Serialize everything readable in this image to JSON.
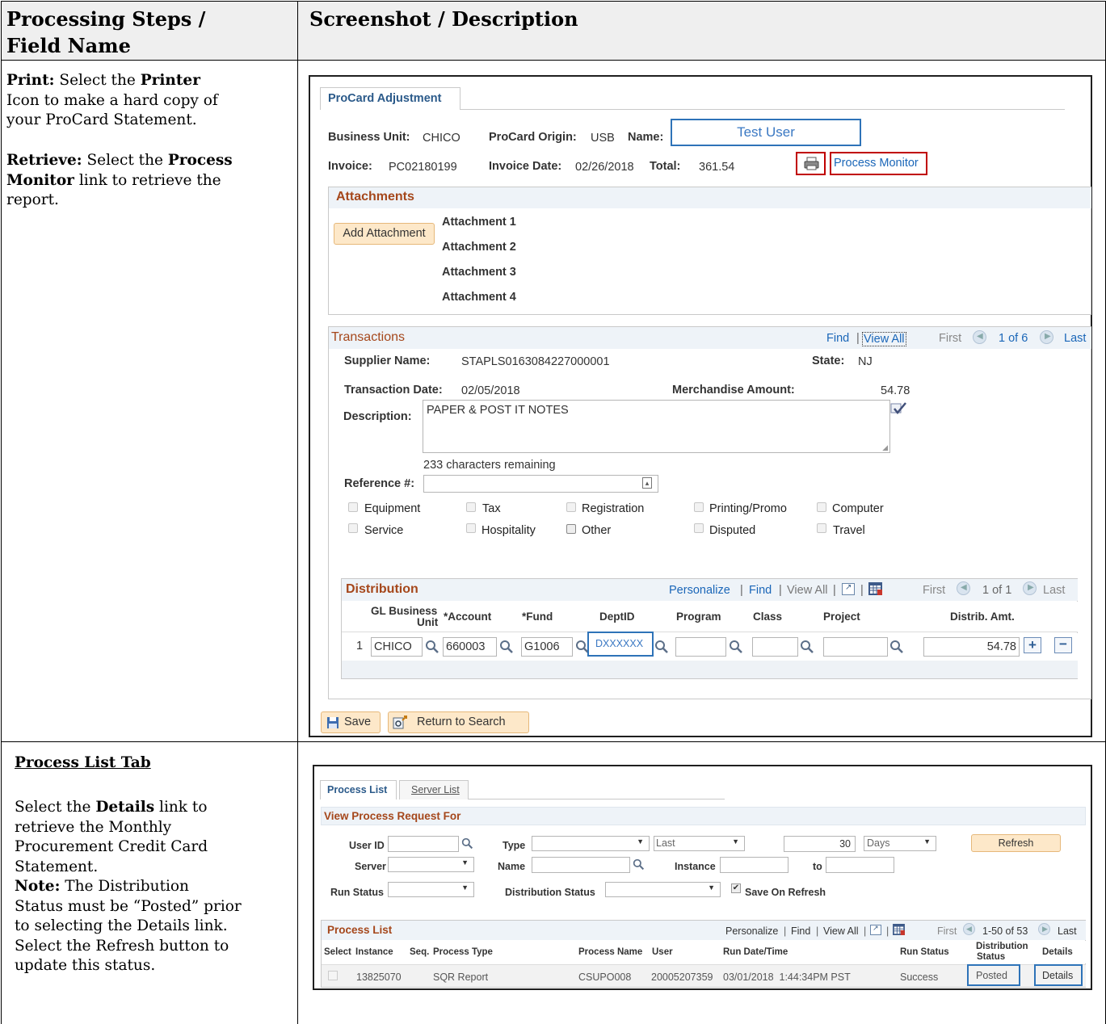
{
  "header": {
    "col1_line1": "Processing Steps /",
    "col1_line2": "Field Name",
    "col2": "Screenshot / Description"
  },
  "row1": {
    "print_label": "Print:",
    "print_t1": " Select the ",
    "print_bold": "Printer",
    "print_t2": "Icon to make a hard copy of",
    "print_t3": "your ProCard Statement.",
    "retrieve_label": "Retrieve:",
    "retrieve_t1": " Select the ",
    "retrieve_bold1": "Process",
    "retrieve_bold2": "Monitor",
    "retrieve_t2": " link to retrieve the",
    "retrieve_t3": "report."
  },
  "procard": {
    "tab": "ProCard Adjustment",
    "bu_label": "Business Unit:",
    "bu_value": "CHICO",
    "origin_label": "ProCard Origin:",
    "origin_value": "USB",
    "name_label": "Name:",
    "name_value": "Test User",
    "invoice_label": "Invoice:",
    "invoice_value": "PC02180199",
    "invdate_label": "Invoice Date:",
    "invdate_value": "02/26/2018",
    "total_label": "Total:",
    "total_value": "361.54",
    "process_monitor": "Process Monitor",
    "attachments_title": "Attachments",
    "add_attachment": "Add Attachment",
    "attachments": [
      "Attachment 1",
      "Attachment 2",
      "Attachment 3",
      "Attachment 4"
    ],
    "transactions_title": "Transactions",
    "find": "Find",
    "view_all": "View All",
    "first": "First",
    "page": "1 of 6",
    "last": "Last",
    "supplier_label": "Supplier Name:",
    "supplier_value": "STAPLS0163084227000001",
    "state_label": "State:",
    "state_value": "NJ",
    "trans_date_label": "Transaction Date:",
    "trans_date_value": "02/05/2018",
    "merch_label": "Merchandise Amount:",
    "merch_value": "54.78",
    "desc_label": "Description:",
    "desc_value": "PAPER & POST IT NOTES",
    "chars_remaining": "233 characters remaining",
    "ref_label": "Reference #:",
    "checkboxes": [
      "Equipment",
      "Tax",
      "Registration",
      "Printing/Promo",
      "Computer",
      "Service",
      "Hospitality",
      "Other",
      "Disputed",
      "Travel"
    ],
    "dist_title": "Distribution",
    "personalize": "Personalize",
    "d_find": "Find",
    "d_view_all": "View All",
    "d_first": "First",
    "d_page": "1 of 1",
    "d_last": "Last",
    "cols": {
      "gl1": "GL Business",
      "gl2": "Unit",
      "account": "*Account",
      "fund": "*Fund",
      "dept": "DeptID",
      "program": "Program",
      "class": "Class",
      "project": "Project",
      "amt": "Distrib. Amt."
    },
    "row": {
      "num": "1",
      "gl": "CHICO",
      "account": "660003",
      "fund": "G1006",
      "dept": "DXXXXXX",
      "amt": "54.78"
    },
    "save": "Save",
    "return": "Return to Search"
  },
  "row2": {
    "title": "Process List Tab",
    "lines": [
      "Select the ",
      "Details",
      " link to",
      "retrieve the Monthly",
      "Procurement Credit Card",
      "Statement."
    ],
    "note_label": "Note:",
    "note_lines": [
      " The Distribution",
      "Status must be “Posted” prior",
      "to selecting the Details link.",
      "Select the Refresh button to",
      "update this status."
    ]
  },
  "pm": {
    "tab1": "Process List",
    "tab2": "Server List",
    "section": "View Process Request For",
    "userid": "User ID",
    "type": "Type",
    "last_sel": "Last",
    "num": "30",
    "days": "Days",
    "refresh": "Refresh",
    "server": "Server",
    "name": "Name",
    "instance": "Instance",
    "to": "to",
    "run_status": "Run Status",
    "dist_status": "Distribution Status",
    "save_on_refresh": "Save On Refresh",
    "list_title": "Process List",
    "personalize": "Personalize",
    "find": "Find",
    "view_all": "View All",
    "first": "First",
    "range": "1-50 of 53",
    "last": "Last",
    "cols": {
      "select": "Select",
      "instance": "Instance",
      "seq": "Seq.",
      "ptype": "Process Type",
      "pname": "Process Name",
      "user": "User",
      "rundt": "Run Date/Time",
      "runstatus": "Run Status",
      "dist1": "Distribution",
      "dist2": "Status",
      "details": "Details"
    },
    "row": {
      "instance": "13825070",
      "ptype": "SQR Report",
      "pname": "CSUPO008",
      "user": "20005207359",
      "rundt": "03/01/2018  1:44:34PM PST",
      "runstatus": "Success",
      "dist": "Posted",
      "details": "Details"
    }
  }
}
